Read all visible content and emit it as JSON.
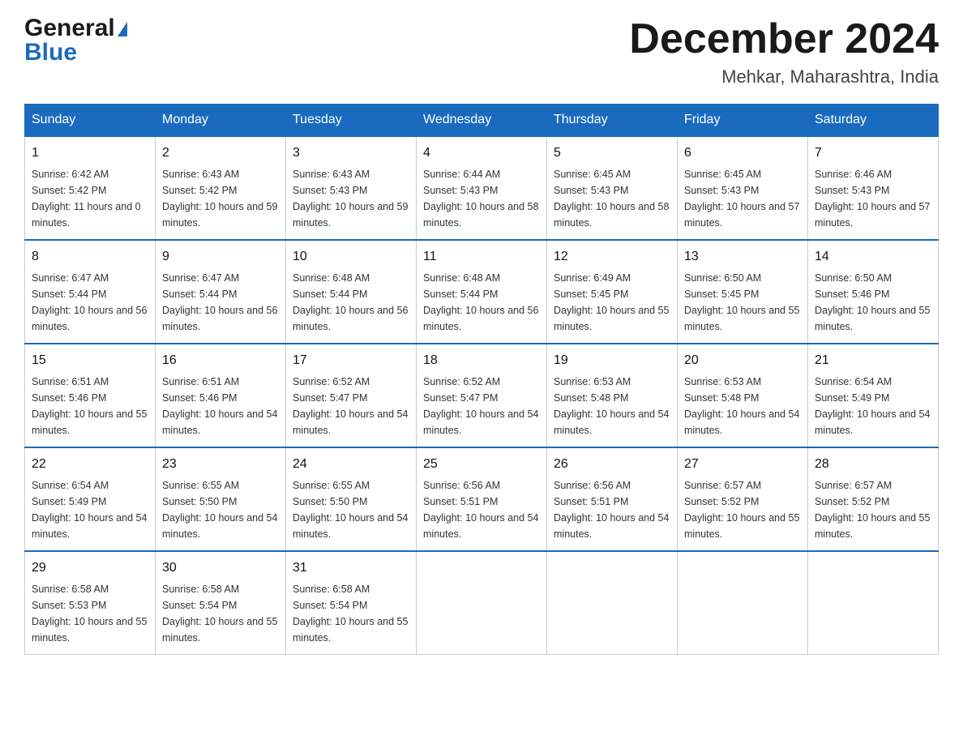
{
  "header": {
    "logo_general": "General",
    "logo_blue": "Blue",
    "month_title": "December 2024",
    "location": "Mehkar, Maharashtra, India"
  },
  "weekdays": [
    "Sunday",
    "Monday",
    "Tuesday",
    "Wednesday",
    "Thursday",
    "Friday",
    "Saturday"
  ],
  "weeks": [
    [
      {
        "day": "1",
        "sunrise": "6:42 AM",
        "sunset": "5:42 PM",
        "daylight": "11 hours and 0 minutes."
      },
      {
        "day": "2",
        "sunrise": "6:43 AM",
        "sunset": "5:42 PM",
        "daylight": "10 hours and 59 minutes."
      },
      {
        "day": "3",
        "sunrise": "6:43 AM",
        "sunset": "5:43 PM",
        "daylight": "10 hours and 59 minutes."
      },
      {
        "day": "4",
        "sunrise": "6:44 AM",
        "sunset": "5:43 PM",
        "daylight": "10 hours and 58 minutes."
      },
      {
        "day": "5",
        "sunrise": "6:45 AM",
        "sunset": "5:43 PM",
        "daylight": "10 hours and 58 minutes."
      },
      {
        "day": "6",
        "sunrise": "6:45 AM",
        "sunset": "5:43 PM",
        "daylight": "10 hours and 57 minutes."
      },
      {
        "day": "7",
        "sunrise": "6:46 AM",
        "sunset": "5:43 PM",
        "daylight": "10 hours and 57 minutes."
      }
    ],
    [
      {
        "day": "8",
        "sunrise": "6:47 AM",
        "sunset": "5:44 PM",
        "daylight": "10 hours and 56 minutes."
      },
      {
        "day": "9",
        "sunrise": "6:47 AM",
        "sunset": "5:44 PM",
        "daylight": "10 hours and 56 minutes."
      },
      {
        "day": "10",
        "sunrise": "6:48 AM",
        "sunset": "5:44 PM",
        "daylight": "10 hours and 56 minutes."
      },
      {
        "day": "11",
        "sunrise": "6:48 AM",
        "sunset": "5:44 PM",
        "daylight": "10 hours and 56 minutes."
      },
      {
        "day": "12",
        "sunrise": "6:49 AM",
        "sunset": "5:45 PM",
        "daylight": "10 hours and 55 minutes."
      },
      {
        "day": "13",
        "sunrise": "6:50 AM",
        "sunset": "5:45 PM",
        "daylight": "10 hours and 55 minutes."
      },
      {
        "day": "14",
        "sunrise": "6:50 AM",
        "sunset": "5:46 PM",
        "daylight": "10 hours and 55 minutes."
      }
    ],
    [
      {
        "day": "15",
        "sunrise": "6:51 AM",
        "sunset": "5:46 PM",
        "daylight": "10 hours and 55 minutes."
      },
      {
        "day": "16",
        "sunrise": "6:51 AM",
        "sunset": "5:46 PM",
        "daylight": "10 hours and 54 minutes."
      },
      {
        "day": "17",
        "sunrise": "6:52 AM",
        "sunset": "5:47 PM",
        "daylight": "10 hours and 54 minutes."
      },
      {
        "day": "18",
        "sunrise": "6:52 AM",
        "sunset": "5:47 PM",
        "daylight": "10 hours and 54 minutes."
      },
      {
        "day": "19",
        "sunrise": "6:53 AM",
        "sunset": "5:48 PM",
        "daylight": "10 hours and 54 minutes."
      },
      {
        "day": "20",
        "sunrise": "6:53 AM",
        "sunset": "5:48 PM",
        "daylight": "10 hours and 54 minutes."
      },
      {
        "day": "21",
        "sunrise": "6:54 AM",
        "sunset": "5:49 PM",
        "daylight": "10 hours and 54 minutes."
      }
    ],
    [
      {
        "day": "22",
        "sunrise": "6:54 AM",
        "sunset": "5:49 PM",
        "daylight": "10 hours and 54 minutes."
      },
      {
        "day": "23",
        "sunrise": "6:55 AM",
        "sunset": "5:50 PM",
        "daylight": "10 hours and 54 minutes."
      },
      {
        "day": "24",
        "sunrise": "6:55 AM",
        "sunset": "5:50 PM",
        "daylight": "10 hours and 54 minutes."
      },
      {
        "day": "25",
        "sunrise": "6:56 AM",
        "sunset": "5:51 PM",
        "daylight": "10 hours and 54 minutes."
      },
      {
        "day": "26",
        "sunrise": "6:56 AM",
        "sunset": "5:51 PM",
        "daylight": "10 hours and 54 minutes."
      },
      {
        "day": "27",
        "sunrise": "6:57 AM",
        "sunset": "5:52 PM",
        "daylight": "10 hours and 55 minutes."
      },
      {
        "day": "28",
        "sunrise": "6:57 AM",
        "sunset": "5:52 PM",
        "daylight": "10 hours and 55 minutes."
      }
    ],
    [
      {
        "day": "29",
        "sunrise": "6:58 AM",
        "sunset": "5:53 PM",
        "daylight": "10 hours and 55 minutes."
      },
      {
        "day": "30",
        "sunrise": "6:58 AM",
        "sunset": "5:54 PM",
        "daylight": "10 hours and 55 minutes."
      },
      {
        "day": "31",
        "sunrise": "6:58 AM",
        "sunset": "5:54 PM",
        "daylight": "10 hours and 55 minutes."
      },
      null,
      null,
      null,
      null
    ]
  ]
}
